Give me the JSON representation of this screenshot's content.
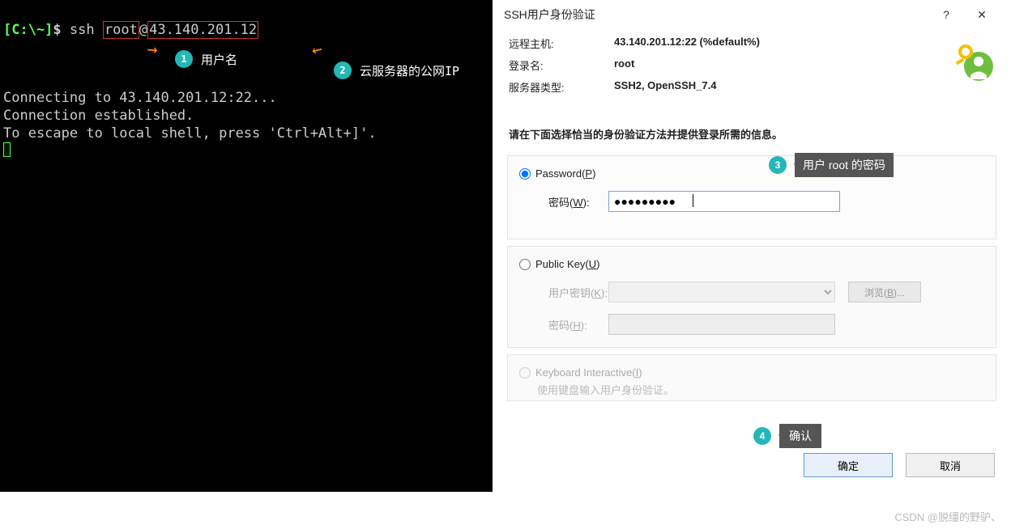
{
  "terminal": {
    "prompt_path": "[C:\\~]",
    "prompt_dollar": "$",
    "cmd_ssh": "ssh",
    "cmd_user": "root",
    "cmd_at": "@",
    "cmd_host": "43.140.201.12",
    "line_connecting": "Connecting to 43.140.201.12:22...",
    "line_established": "Connection established.",
    "line_escape": "To escape to local shell, press 'Ctrl+Alt+]'."
  },
  "annotations": {
    "n1": "1",
    "t1": "用户名",
    "n2": "2",
    "t2": "云服务器的公网IP",
    "n3": "3",
    "t3": "用户 root 的密码",
    "n4": "4",
    "t4": "确认"
  },
  "dialog": {
    "title": "SSH用户身份验证",
    "help": "?",
    "close": "✕",
    "remote_host_label": "远程主机:",
    "remote_host_value": "43.140.201.12:22 (%default%)",
    "login_label": "登录名:",
    "login_value": "root",
    "server_type_label": "服务器类型:",
    "server_type_value": "SSH2, OpenSSH_7.4",
    "instruction": "请在下面选择恰当的身份验证方法并提供登录所需的信息。",
    "password_radio": "Password(",
    "password_u": "P",
    "password_radio2": ")",
    "password_field_label": "密码(",
    "password_field_u": "W",
    "password_field_label2": "):",
    "password_value": "●●●●●●●●●",
    "pubkey_radio": "Public Key(",
    "pubkey_u": "U",
    "pubkey_radio2": ")",
    "userkey_label": "用户密钥(",
    "userkey_u": "K",
    "userkey_label2": "):",
    "pubpass_label": "密码(",
    "pubpass_u": "H",
    "pubpass_label2": "):",
    "browse_btn": "浏览(",
    "browse_u": "B",
    "browse_btn2": ")...",
    "kbd_radio": "Keyboard Interactive(",
    "kbd_u": "I",
    "kbd_radio2": ")",
    "kbd_hint": "使用键盘输入用户身份验证。",
    "ok": "确定",
    "cancel": "取消"
  },
  "watermark": "CSDN @脱缰的野驴、"
}
